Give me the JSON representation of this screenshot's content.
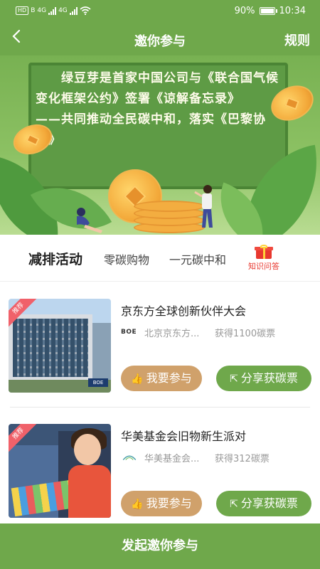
{
  "status_bar": {
    "hd_label": "HD",
    "net_label": "B",
    "network_1": "4G",
    "network_2": "4G",
    "battery": "90%",
    "time": "10:34"
  },
  "header": {
    "back_icon": "chevron-left-icon",
    "title": "邀你参与",
    "rules_label": "规则"
  },
  "banner": {
    "paragraph_1": "绿豆芽是首家中国公司与《联合国气候变化框架公约》签署《谅解备忘录》",
    "paragraph_2": "——共同推动全民碳中和，落实《巴黎协定》"
  },
  "tabs": [
    {
      "label": "减排活动",
      "active": true
    },
    {
      "label": "零碳购物",
      "active": false
    },
    {
      "label": "一元碳中和",
      "active": false
    }
  ],
  "quiz": {
    "icon": "gift-icon",
    "label": "知识问答"
  },
  "activities": [
    {
      "tag": "推荐",
      "title": "京东方全球创新伙伴大会",
      "org_logo": "BOE",
      "org_name": "北京京东方...",
      "reward": "获得1100碳票",
      "sign_text": "BOE",
      "join_label": "我要参与",
      "share_label": "分享获碳票"
    },
    {
      "tag": "推荐",
      "title": "华美基金会旧物新生派对",
      "org_logo": "",
      "org_name": "华美基金会...",
      "reward": "获得312碳票",
      "join_label": "我要参与",
      "share_label": "分享获碳票"
    }
  ],
  "bottom": {
    "label": "发起邀你参与"
  },
  "colors": {
    "primary_green": "#6fa84b",
    "join_tan": "#d0a16b",
    "tag_red": "#f0616a"
  }
}
